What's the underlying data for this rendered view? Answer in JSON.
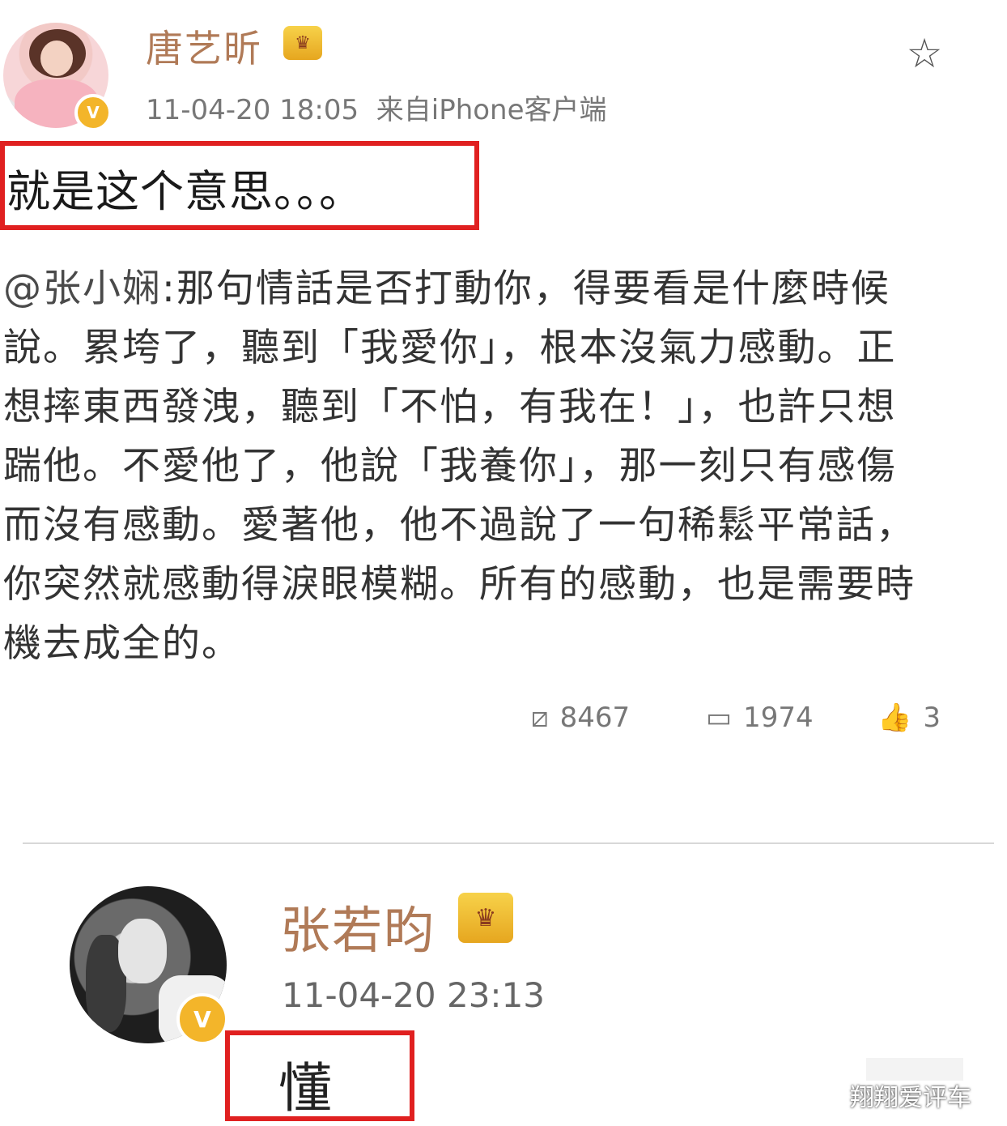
{
  "post1": {
    "username": "唐艺昕",
    "timestamp": "11-04-20 18:05",
    "source": "来自iPhone客户端",
    "verified_icon": "verified-v-icon",
    "crown_icon": "vip-crown-icon",
    "favorite_icon": "star-outline-icon",
    "text": "就是这个意思。。。",
    "quote": {
      "mention": "@张小娴",
      "body": ":那句情話是否打動你，得要看是什麼時候說。累垮了，聽到「我愛你」，根本沒氣力感動。正想摔東西發洩，聽到「不怕，有我在！」，也許只想踹他。不愛他了，他說「我養你」，那一刻只有感傷而沒有感動。愛著他，他不過說了一句稀鬆平常話，你突然就感動得淚眼模糊。所有的感動，也是需要時機去成全的。"
    },
    "actions": {
      "repost_count": "8467",
      "comment_count": "1974",
      "like_count": "3"
    }
  },
  "post2": {
    "username": "张若昀",
    "timestamp": "11-04-20 23:13",
    "verified_icon": "verified-v-icon",
    "crown_icon": "vip-crown-icon",
    "text": "懂"
  },
  "watermark": "翔翔爱评车",
  "colors": {
    "username": "#b07a57",
    "highlight_border": "#e02020",
    "verified_badge": "#f3b52a",
    "meta_text": "#777777"
  }
}
